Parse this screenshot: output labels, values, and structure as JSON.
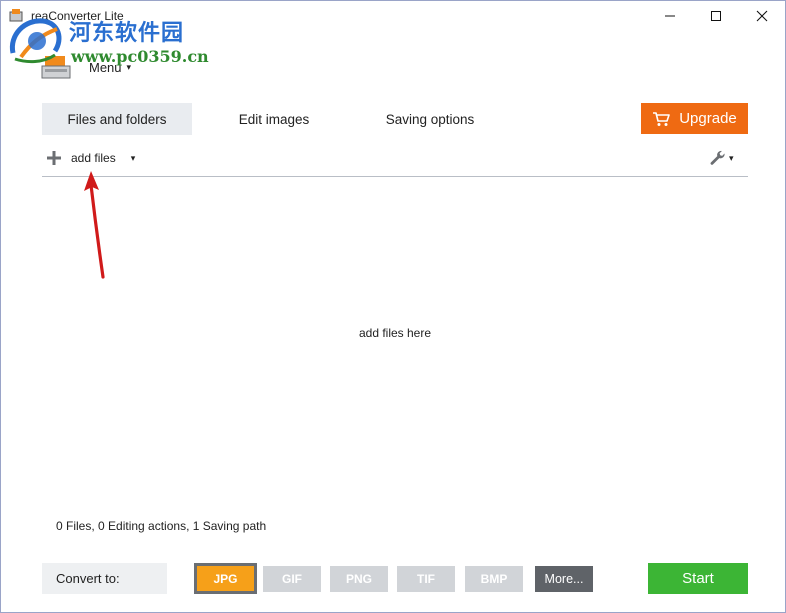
{
  "window": {
    "title": "reaConverter Lite",
    "minimize_label": "—",
    "maximize_label": "☐",
    "close_label": "✕"
  },
  "watermark": {
    "site_name": "河东软件园",
    "url": "www.pc0359.cn"
  },
  "menu": {
    "label": "Menu",
    "caret": "▾"
  },
  "tabs": [
    {
      "label": "Files and folders",
      "active": true
    },
    {
      "label": "Edit images",
      "active": false
    },
    {
      "label": "Saving options",
      "active": false
    }
  ],
  "upgrade": {
    "label": "Upgrade",
    "icon": "cart-icon",
    "color": "#ef6a12"
  },
  "toolbar": {
    "add_files_label": "add files",
    "add_files_icon": "plus-icon",
    "add_files_caret": "▾",
    "tools_icon": "wrench-icon",
    "tools_caret": "▾"
  },
  "drop_area": {
    "hint": "add files here",
    "annotation_arrow_color": "#d01a1a"
  },
  "status": {
    "text": "0 Files,  0 Editing actions,  1 Saving path"
  },
  "bottom": {
    "convert_to_label": "Convert to:",
    "formats": [
      {
        "label": "JPG",
        "selected": true
      },
      {
        "label": "GIF",
        "selected": false
      },
      {
        "label": "PNG",
        "selected": false
      },
      {
        "label": "TIF",
        "selected": false
      },
      {
        "label": "BMP",
        "selected": false
      }
    ],
    "more_label": "More...",
    "start_label": "Start",
    "selected_color": "#f6a019",
    "start_color": "#3cb535"
  }
}
